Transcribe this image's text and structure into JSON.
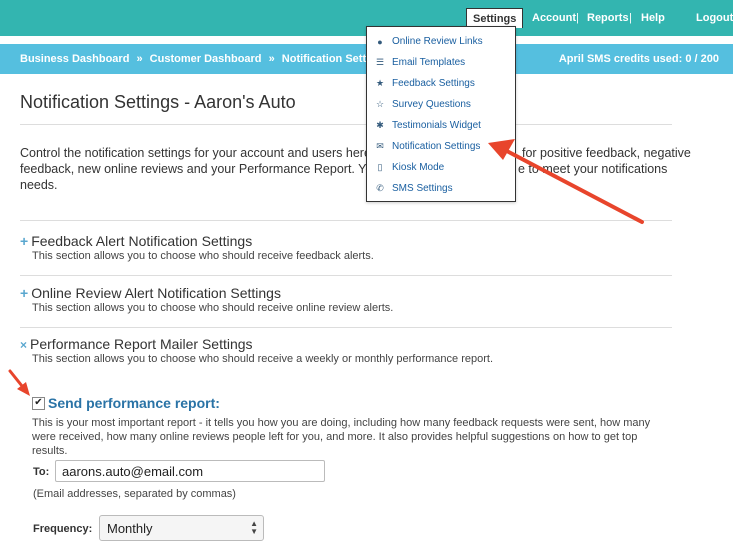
{
  "topnav": {
    "settings": "Settings",
    "account": "Account",
    "reports": "Reports",
    "help": "Help",
    "logout": "Logout",
    "separator": "|"
  },
  "subbar": {
    "breadcrumbs": [
      "Business Dashboard",
      "»",
      "Customer Dashboard",
      "»",
      "Notification Settings"
    ],
    "credits": "April SMS credits used: 0 / 200"
  },
  "page": {
    "title": "Notification Settings - Aaron's Auto",
    "intro_part1": "Control the notification settings for your account and users here. S",
    "intro_part2": "for positive feedback, negative",
    "intro_part3": "feedback, new online reviews and your Performance Report. You",
    "intro_part4": "e to meet your notifications",
    "intro_part5": "needs."
  },
  "dropdown": {
    "items": [
      {
        "label": "Online Review Links",
        "icon": "globe-icon"
      },
      {
        "label": "Email Templates",
        "icon": "list-icon"
      },
      {
        "label": "Feedback Settings",
        "icon": "star-icon"
      },
      {
        "label": "Survey Questions",
        "icon": "star-outline-icon"
      },
      {
        "label": "Testimonials Widget",
        "icon": "gear-icon"
      },
      {
        "label": "Notification Settings",
        "icon": "envelope-icon"
      },
      {
        "label": "Kiosk Mode",
        "icon": "tablet-icon"
      },
      {
        "label": "SMS Settings",
        "icon": "phone-icon"
      }
    ]
  },
  "sections": [
    {
      "title": "Feedback Alert Notification Settings",
      "desc": "This section allows you to choose who should receive feedback alerts.",
      "toggle": "+"
    },
    {
      "title": "Online Review Alert Notification Settings",
      "desc": "This section allows you to choose who should receive online review alerts.",
      "toggle": "+"
    },
    {
      "title": "Performance Report Mailer Settings",
      "desc": "This section allows you to choose who should receive a weekly or monthly performance report.",
      "toggle": "×"
    }
  ],
  "report": {
    "checkbox_label": "Send performance report:",
    "checked_mark": "✔",
    "description": "This is your most important report - it tells you how you are doing, including how many feedback requests were sent, how many were received, how many online reviews people left for you, and more. It also provides helpful suggestions on how to get top results.",
    "to_label": "To:",
    "to_value": "aarons.auto@email.com",
    "to_hint": "(Email addresses, separated by commas)",
    "frequency_label": "Frequency:",
    "frequency_value": "Monthly"
  },
  "colors": {
    "topbar": "#33b5b0",
    "subbar": "#55bfdf",
    "arrow": "#e8452c",
    "link": "#1a5fa0"
  }
}
